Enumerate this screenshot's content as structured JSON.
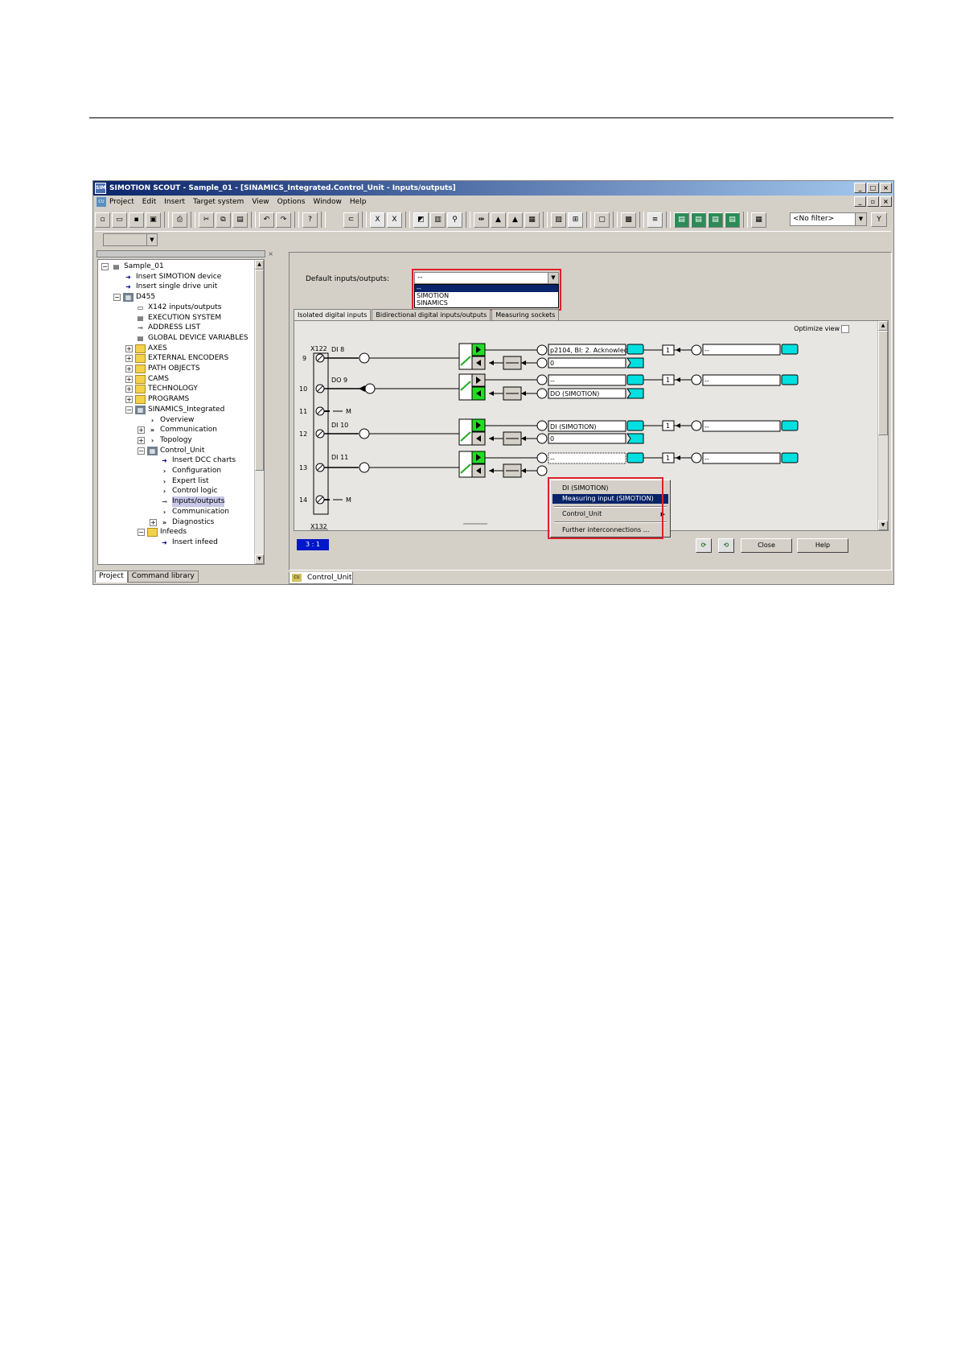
{
  "window": {
    "title": "SIMOTION SCOUT - Sample_01 - [SINAMICS_Integrated.Control_Unit - Inputs/outputs]",
    "app_icon": "SIMOTION",
    "controls": [
      "_",
      "□",
      "×"
    ],
    "child_controls": [
      "_",
      "▫",
      "×"
    ]
  },
  "menu": {
    "doc_icon": "CU",
    "items": [
      "Project",
      "Edit",
      "Insert",
      "Target system",
      "View",
      "Options",
      "Window",
      "Help"
    ]
  },
  "toolbar": {
    "filter_value": "<No filter>"
  },
  "tree": {
    "nodes": [
      {
        "label": "Sample_01",
        "indent": 0,
        "exp": "−",
        "icon": "project"
      },
      {
        "label": "Insert SIMOTION device",
        "indent": 1,
        "exp": "",
        "icon": "star"
      },
      {
        "label": "Insert single drive unit",
        "indent": 1,
        "exp": "",
        "icon": "star"
      },
      {
        "label": "D455",
        "indent": 1,
        "exp": "−",
        "icon": "dev"
      },
      {
        "label": "X142 inputs/outputs",
        "indent": 2,
        "exp": "",
        "icon": "io"
      },
      {
        "label": "EXECUTION SYSTEM",
        "indent": 2,
        "exp": "",
        "icon": "doc"
      },
      {
        "label": "ADDRESS LIST",
        "indent": 2,
        "exp": "",
        "icon": "link"
      },
      {
        "label": "GLOBAL DEVICE VARIABLES",
        "indent": 2,
        "exp": "",
        "icon": "doc"
      },
      {
        "label": "AXES",
        "indent": 2,
        "exp": "+",
        "icon": "folder"
      },
      {
        "label": "EXTERNAL ENCODERS",
        "indent": 2,
        "exp": "+",
        "icon": "folder"
      },
      {
        "label": "PATH OBJECTS",
        "indent": 2,
        "exp": "+",
        "icon": "folder"
      },
      {
        "label": "CAMS",
        "indent": 2,
        "exp": "+",
        "icon": "folder"
      },
      {
        "label": "TECHNOLOGY",
        "indent": 2,
        "exp": "+",
        "icon": "folder"
      },
      {
        "label": "PROGRAMS",
        "indent": 2,
        "exp": "+",
        "icon": "folder"
      },
      {
        "label": "SINAMICS_Integrated",
        "indent": 2,
        "exp": "−",
        "icon": "dev"
      },
      {
        "label": "Overview",
        "indent": 3,
        "exp": "",
        "icon": "chev"
      },
      {
        "label": "Communication",
        "indent": 3,
        "exp": "+",
        "icon": "dchev"
      },
      {
        "label": "Topology",
        "indent": 3,
        "exp": "+",
        "icon": "chev"
      },
      {
        "label": "Control_Unit",
        "indent": 3,
        "exp": "−",
        "icon": "dev"
      },
      {
        "label": "Insert DCC charts",
        "indent": 4,
        "exp": "",
        "icon": "star"
      },
      {
        "label": "Configuration",
        "indent": 4,
        "exp": "",
        "icon": "chev"
      },
      {
        "label": "Expert list",
        "indent": 4,
        "exp": "",
        "icon": "chev"
      },
      {
        "label": "Control logic",
        "indent": 4,
        "exp": "",
        "icon": "chev"
      },
      {
        "label": "Inputs/outputs",
        "indent": 4,
        "exp": "",
        "icon": "link",
        "selected": true
      },
      {
        "label": "Communication",
        "indent": 4,
        "exp": "",
        "icon": "chev"
      },
      {
        "label": "Diagnostics",
        "indent": 4,
        "exp": "+",
        "icon": "dchev"
      },
      {
        "label": "Infeeds",
        "indent": 3,
        "exp": "−",
        "icon": "folder"
      },
      {
        "label": "Insert infeed",
        "indent": 4,
        "exp": "",
        "icon": "star"
      }
    ]
  },
  "bottom_tabs": [
    "Project",
    "Command library"
  ],
  "doc_tab": {
    "icon": "CU",
    "label": "Control_Unit"
  },
  "default_io": {
    "label": "Default inputs/outputs:",
    "value": "--",
    "options": [
      "--",
      "SIMOTION",
      "SINAMICS"
    ]
  },
  "tabs": [
    "Isolated digital inputs",
    "Bidirectional digital inputs/outputs",
    "Measuring sockets"
  ],
  "optimize_view": "Optimize view",
  "connector": {
    "name": "X122",
    "bottom": "X132"
  },
  "rows": [
    {
      "pin": "9",
      "label": "DI 8",
      "top_field": "p2104, BI: 2. Acknowlec",
      "bottom_field": "0",
      "right_field": "--"
    },
    {
      "pin": "10",
      "label": "DO 9",
      "top_field": "--",
      "bottom_field": "DO (SIMOTION)",
      "right_field": "--"
    },
    {
      "pin": "11",
      "label": "M"
    },
    {
      "pin": "12",
      "label": "DI 10",
      "top_field": "DI (SIMOTION)",
      "bottom_field": "0",
      "right_field": "--"
    },
    {
      "pin": "13",
      "label": "DI 11",
      "top_field": "--",
      "bottom_field": "",
      "right_field": "--"
    },
    {
      "pin": "14",
      "label": "M"
    }
  ],
  "inverter_label": "1",
  "context_menu": {
    "items": [
      "DI (SIMOTION)",
      "Measuring input (SIMOTION)",
      "Control_Unit",
      "Further interconnections ..."
    ]
  },
  "status": {
    "ratio": "3 : 1",
    "close": "Close",
    "help": "Help"
  }
}
